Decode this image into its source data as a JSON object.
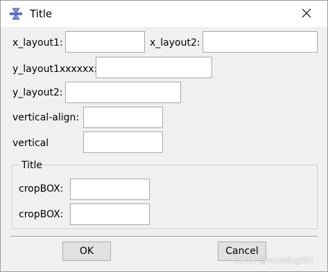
{
  "window": {
    "title": "Title",
    "app_icon": "hourglass-app-icon",
    "close_icon": "close-icon"
  },
  "form": {
    "x_layout1_label": "x_layout1:",
    "x_layout1_value": "",
    "x_layout2_label": "x_layout2:",
    "x_layout2_value": "",
    "y_layout1_label": "y_layout1xxxxxx:",
    "y_layout1_value": "",
    "y_layout2_label": "y_layout2:",
    "y_layout2_value": "",
    "vertical_align_label": "vertical-align:",
    "vertical_align_value": "",
    "vertical_label": "vertical",
    "vertical_value": ""
  },
  "group": {
    "title": "Title",
    "crop1_label": "cropBOX:",
    "crop1_value": "",
    "crop2_label": "cropBOX:",
    "crop2_value": ""
  },
  "buttons": {
    "ok_label": "OK",
    "cancel_label": "Cancel"
  },
  "watermark": "CSDN @wumingdhi"
}
